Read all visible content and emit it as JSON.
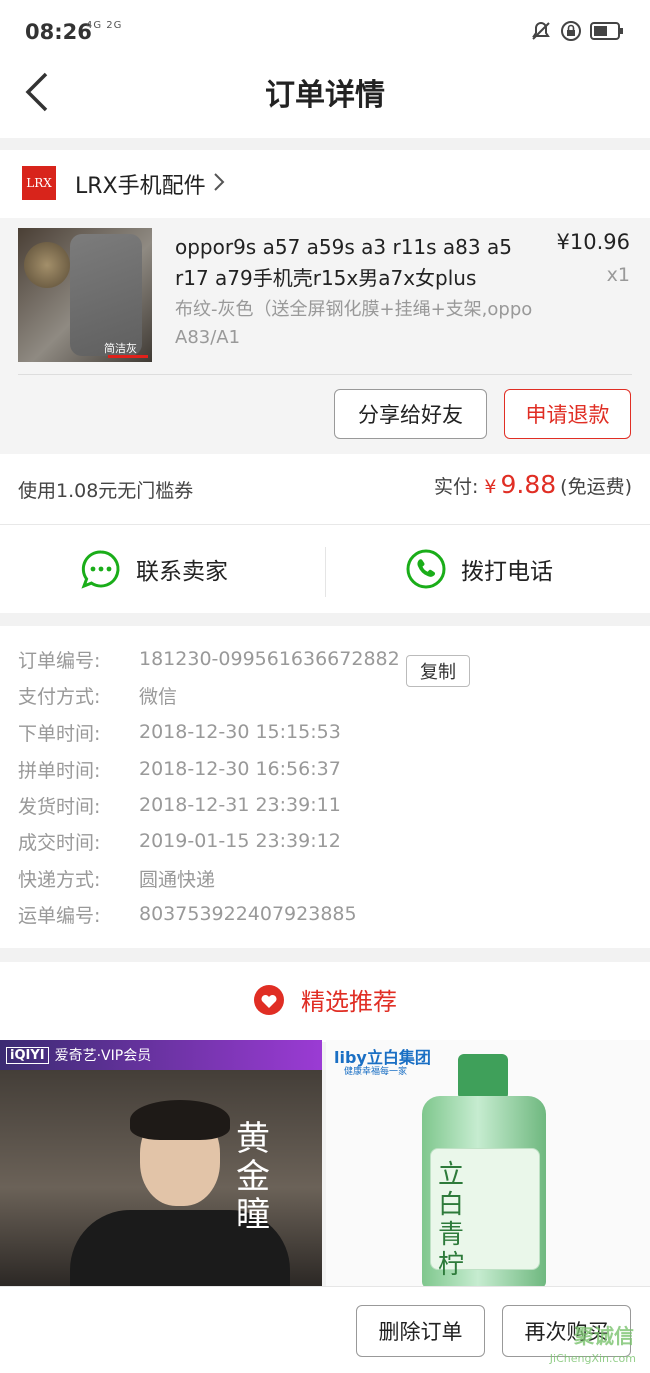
{
  "status": {
    "time": "08:26",
    "network": "4G 2G"
  },
  "header": {
    "title": "订单详情"
  },
  "shop": {
    "logo_text": "LRX",
    "name": "LRX手机配件"
  },
  "product": {
    "title": "oppor9s a57 a59s a3 r11s a83 a5 r17 a79手机壳r15x男a7x女plus",
    "spec": "布纹-灰色（送全屏钢化膜+挂绳+支架,oppo A83/A1",
    "price": "¥10.96",
    "qty": "x1",
    "thumb_tag": "简洁灰"
  },
  "actions": {
    "share": "分享给好友",
    "refund": "申请退款"
  },
  "payment": {
    "coupon": "使用1.08元无门槛券",
    "paid_label": "实付:",
    "currency": "¥",
    "amount": "9.88",
    "shipping_note": "(免运费)"
  },
  "contact": {
    "seller": "联系卖家",
    "call": "拨打电话"
  },
  "order_info": {
    "copy_label": "复制",
    "rows": [
      {
        "label": "订单编号:",
        "value": "181230-099561636672882"
      },
      {
        "label": "支付方式:",
        "value": "微信"
      },
      {
        "label": "下单时间:",
        "value": "2018-12-30 15:15:53"
      },
      {
        "label": "拼单时间:",
        "value": "2018-12-30 16:56:37"
      },
      {
        "label": "发货时间:",
        "value": "2018-12-31 23:39:11"
      },
      {
        "label": "成交时间:",
        "value": "2019-01-15 23:39:12"
      },
      {
        "label": "快递方式:",
        "value": "圆通快递"
      },
      {
        "label": "运单编号:",
        "value": "803753922407923885"
      }
    ]
  },
  "recommend": {
    "title": "精选推荐",
    "left_brand": "iQIYI",
    "left_caption": "爱奇艺·VIP会员",
    "left_title_art": "黄金瞳",
    "right_brand": "liby立白集团",
    "right_sub": "健康幸福每一家",
    "right_art": "立白青柠"
  },
  "bottom": {
    "delete": "删除订单",
    "rebuy": "再次购买"
  },
  "watermark": {
    "main": "聚诚信",
    "sub": "JiChengXin.com"
  },
  "colors": {
    "accent": "#e02e24",
    "wechat_green": "#1aad19",
    "background": "#f2f2f2"
  },
  "icons": [
    "back-arrow-icon",
    "chevron-right-icon",
    "chat-bubble-icon",
    "phone-icon",
    "heart-badge-icon",
    "mute-icon",
    "lock-icon",
    "battery-icon"
  ]
}
